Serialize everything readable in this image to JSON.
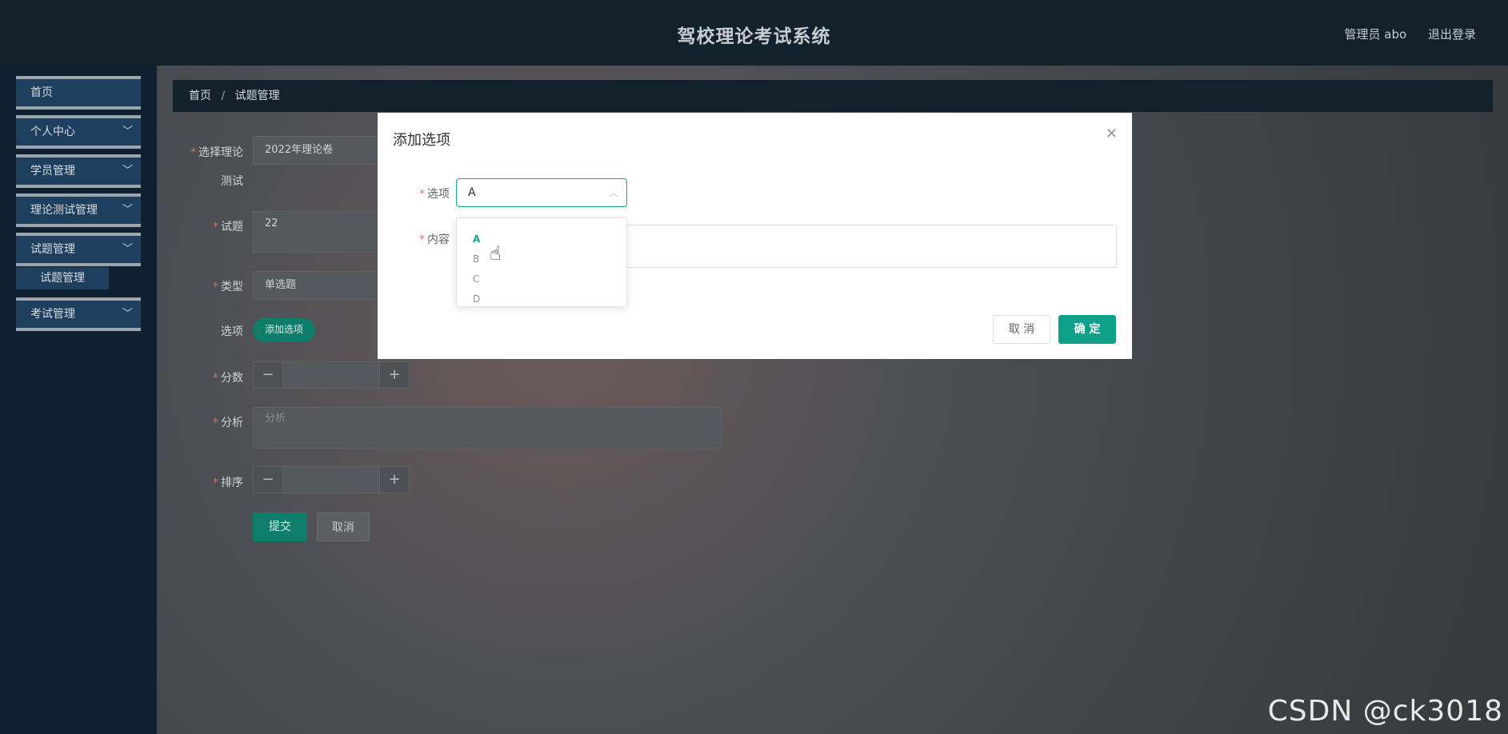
{
  "header": {
    "title": "驾校理论考试系统",
    "user_label": "管理员 abo",
    "logout_label": "退出登录"
  },
  "sidebar": {
    "items": [
      {
        "label": "首页"
      },
      {
        "label": "个人中心"
      },
      {
        "label": "学员管理"
      },
      {
        "label": "理论测试管理"
      },
      {
        "label": "试题管理"
      },
      {
        "label": "考试管理"
      }
    ],
    "submenu_label": "试题管理"
  },
  "breadcrumb": {
    "home": "首页",
    "separator": "/",
    "current": "试题管理"
  },
  "form": {
    "exam_label_line1": "选择理论",
    "exam_label_line2": "测试",
    "exam_value": "2022年理论卷",
    "question_label": "试题",
    "question_value": "22",
    "type_label": "类型",
    "type_value": "单选题",
    "options_label": "选项",
    "add_option_label": "添加选项",
    "score_label": "分数",
    "analysis_label": "分析",
    "analysis_placeholder": "分析",
    "order_label": "排序",
    "submit_label": "提交",
    "cancel_label": "取消"
  },
  "dialog": {
    "title": "添加选项",
    "option_label": "选项",
    "option_value": "A",
    "content_label": "内容",
    "cancel_label": "取 消",
    "confirm_label": "确 定"
  },
  "dropdown": {
    "options": [
      "A",
      "B",
      "C",
      "D"
    ],
    "selected": "A"
  },
  "watermark": "CSDN @ck3018",
  "colors": {
    "accent": "#0fa089",
    "header_bg": "#13212c",
    "sidebar_item_bg": "#1f3f5e"
  }
}
